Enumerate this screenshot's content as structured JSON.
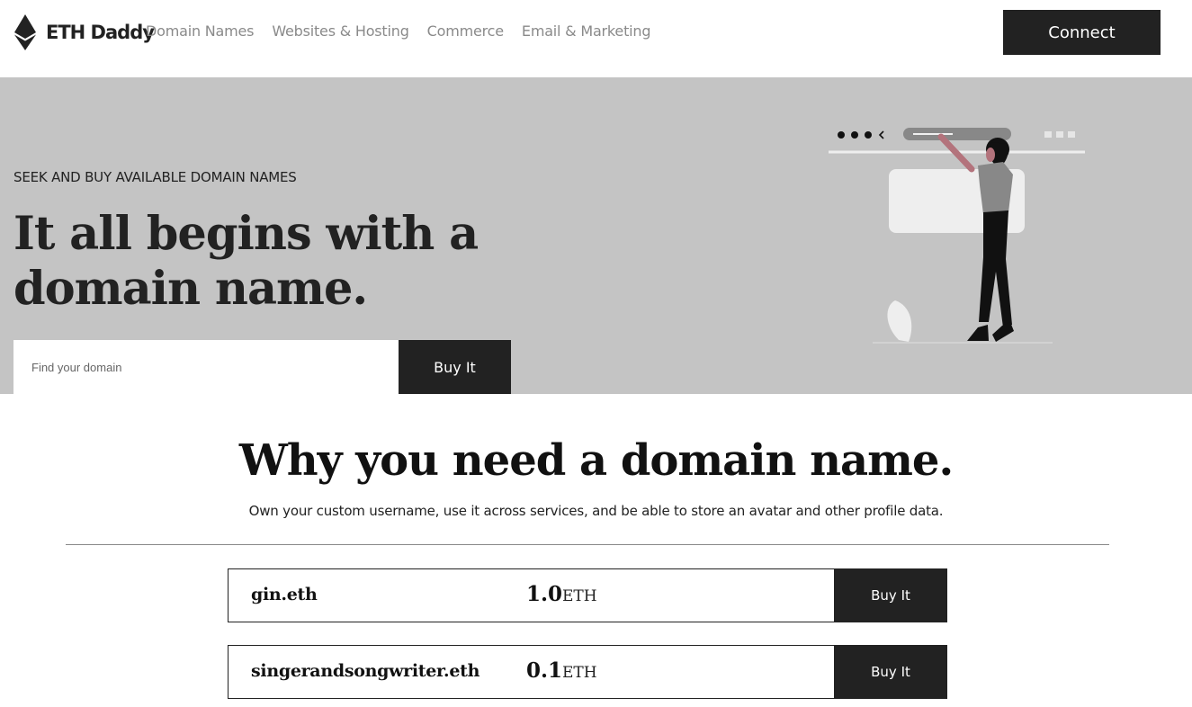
{
  "header": {
    "brand": "ETH Daddy",
    "nav": [
      "Domain Names",
      "Websites & Hosting",
      "Commerce",
      "Email & Marketing"
    ],
    "connect_label": "Connect"
  },
  "hero": {
    "eyebrow": "SEEK AND BUY AVAILABLE DOMAIN NAMES",
    "title": "It all begins with a domain name.",
    "search_placeholder": "Find your domain",
    "buy_label": "Buy It"
  },
  "why": {
    "title": "Why you need a domain name.",
    "subtitle": "Own your custom username, use it across services, and be able to store an avatar and other profile data."
  },
  "listings": [
    {
      "name": "gin.eth",
      "price": "1.0",
      "unit": "ETH",
      "buy_label": "Buy It"
    },
    {
      "name": "singerandsongwriter.eth",
      "price": "0.1",
      "unit": "ETH",
      "buy_label": "Buy It"
    }
  ],
  "colors": {
    "dark": "#222222",
    "hero_bg": "#c4c4c4",
    "accent_figure": "#b3737c"
  },
  "icons": [
    "ethereum-logo-icon"
  ]
}
